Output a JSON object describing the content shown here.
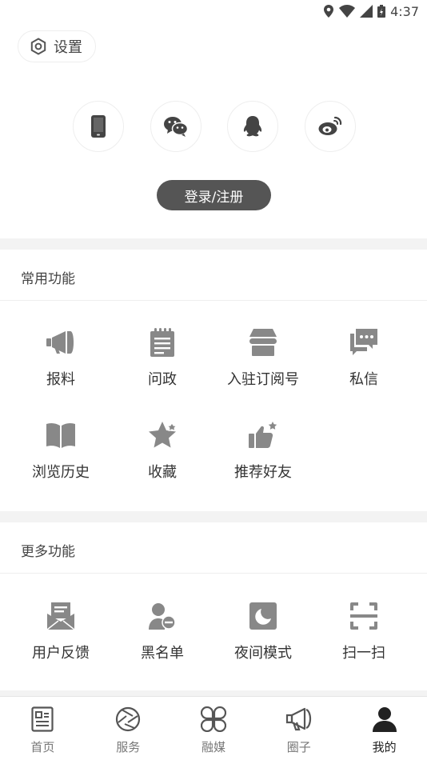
{
  "status_bar": {
    "time": "4:37"
  },
  "header": {
    "settings_label": "设置"
  },
  "login": {
    "social": [
      "phone-icon",
      "wechat-icon",
      "qq-icon",
      "weibo-icon"
    ],
    "button_label": "登录/注册"
  },
  "common": {
    "title": "常用功能",
    "items": [
      {
        "label": "报料",
        "icon": "megaphone-icon"
      },
      {
        "label": "问政",
        "icon": "notepad-icon"
      },
      {
        "label": "入驻订阅号",
        "icon": "store-icon"
      },
      {
        "label": "私信",
        "icon": "message-icon"
      },
      {
        "label": "浏览历史",
        "icon": "book-icon"
      },
      {
        "label": "收藏",
        "icon": "star-icon"
      },
      {
        "label": "推荐好友",
        "icon": "thumbs-up-icon"
      }
    ]
  },
  "more": {
    "title": "更多功能",
    "items": [
      {
        "label": "用户反馈",
        "icon": "mail-icon"
      },
      {
        "label": "黑名单",
        "icon": "block-user-icon"
      },
      {
        "label": "夜间模式",
        "icon": "moon-icon"
      },
      {
        "label": "扫一扫",
        "icon": "scan-icon"
      }
    ]
  },
  "tabbar": {
    "tabs": [
      {
        "label": "首页",
        "icon": "news-icon"
      },
      {
        "label": "服务",
        "icon": "aperture-icon"
      },
      {
        "label": "融媒",
        "icon": "clover-icon"
      },
      {
        "label": "圈子",
        "icon": "megaphone-outline-icon"
      },
      {
        "label": "我的",
        "icon": "user-icon"
      }
    ],
    "active_index": 4
  },
  "colors": {
    "icon_gray": "#888888",
    "button_bg": "#555555",
    "divider": "#f3f3f3"
  }
}
